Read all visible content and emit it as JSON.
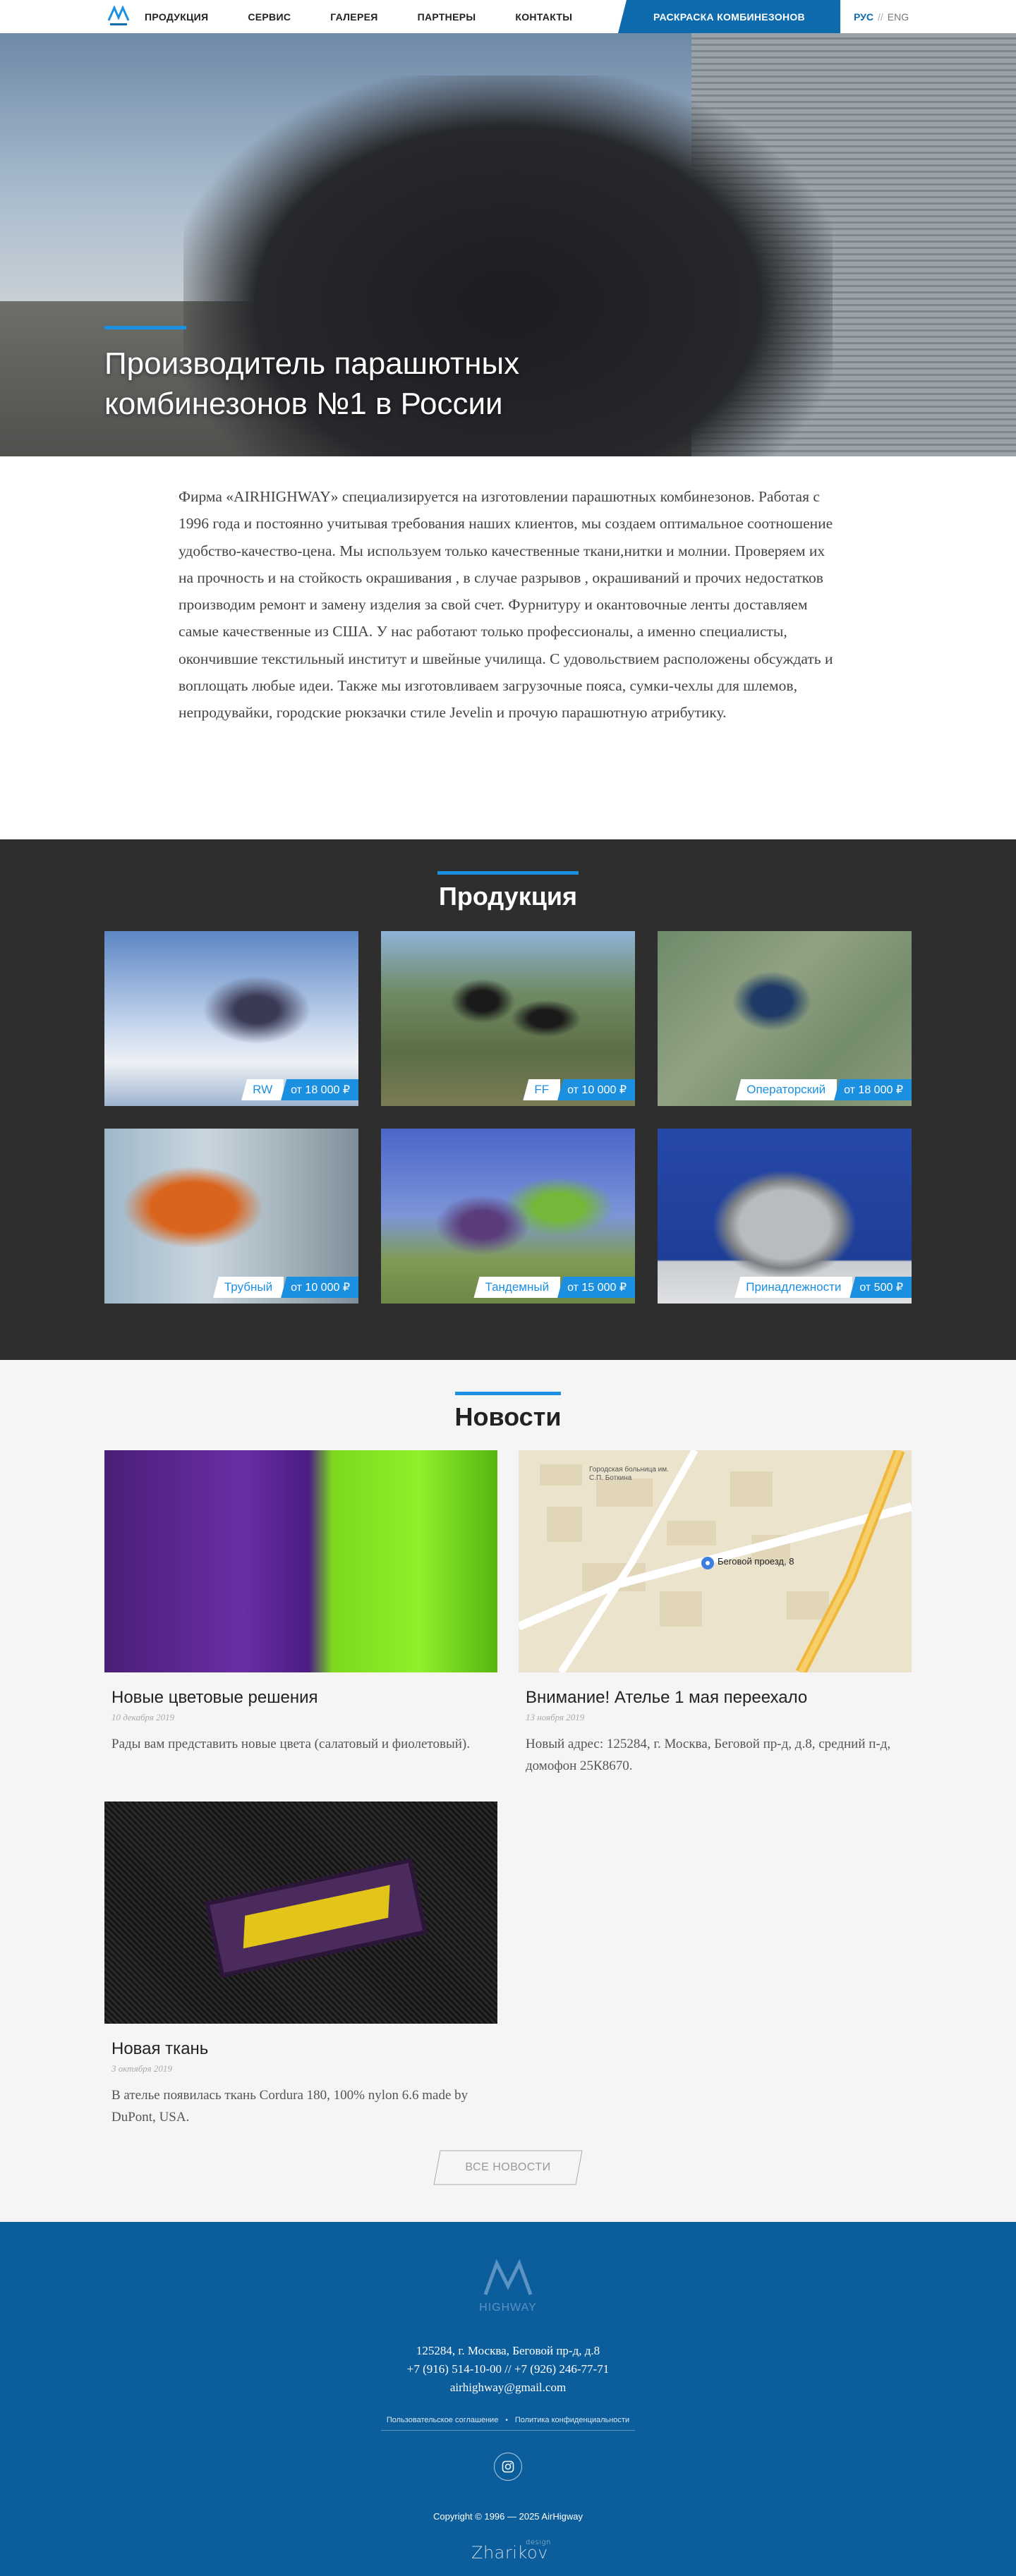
{
  "header": {
    "nav": [
      "ПРОДУКЦИЯ",
      "СЕРВИС",
      "ГАЛЕРЕЯ",
      "ПАРТНЕРЫ",
      "КОНТАКТЫ"
    ],
    "cta": "РАСКРАСКА КОМБИНЕЗОНОВ",
    "lang_active": "РУС",
    "lang_sep": "//",
    "lang_other": "ENG"
  },
  "hero": {
    "title_line1": "Производитель парашютных",
    "title_line2": "комбинезонов №1 в России"
  },
  "intro": {
    "text": "Фирма «AIRHIGHWAY» специализируется на изготовлении парашютных комбинезонов. Работая с 1996 года и постоянно учитывая требования наших клиентов, мы создаем оптимальное соотношение удобство-качество-цена. Мы используем только качественные ткани,нитки и молнии. Проверяем их на прочность  и  на стойкость окрашивания , в случае разрывов , окрашиваний и прочих недостатков производим ремонт и замену изделия за свой счет. Фурнитуру  и окантовочные  ленты доставляем самые качественные из США. У нас работают только профессионалы, а именно специалисты, окончившие текстильный институт и швейные училища. С удовольствием расположены обсуждать и воплощать любые идеи. Также мы изготовливаем загрузочные пояса, сумки-чехлы для шлемов, непродувайки, городские рюкзачки стиле Jevelin и прочую парашютную атрибутику."
  },
  "products": {
    "title": "Продукция",
    "items": [
      {
        "name": "RW",
        "price": "от 18 000 ₽"
      },
      {
        "name": "FF",
        "price": "от 10 000 ₽"
      },
      {
        "name": "Операторский",
        "price": "от 18 000 ₽"
      },
      {
        "name": "Трубный",
        "price": "от 10 000 ₽"
      },
      {
        "name": "Тандемный",
        "price": "от 15 000 ₽"
      },
      {
        "name": "Принадлежности",
        "price": "от 500 ₽"
      }
    ]
  },
  "news": {
    "title": "Новости",
    "items": [
      {
        "title": "Новые цветовые решения",
        "date": "10 декабря 2019",
        "text": "Рады вам представить новые цвета (салатовый и фиолетовый)."
      },
      {
        "title": "Внимание! Ателье 1 мая переехало",
        "date": "13 ноября 2019",
        "text": "Новый адрес: 125284, г. Москва, Беговой пр-д, д.8, средний п-д, домофон 25К8670."
      },
      {
        "title": "Новая ткань",
        "date": "3 октября 2019",
        "text": "В ателье появилась ткань Cordura 180, 100% nylon 6.6 made by DuPont, USA."
      }
    ],
    "map_label": "Беговой проезд, 8",
    "map_hospital": "Городская больница им. С.П. Боткина",
    "all_button": "ВСЕ НОВОСТИ"
  },
  "footer": {
    "logo_top": "AIR",
    "logo_bottom": "HIGHWAY",
    "address": "125284, г. Москва, Беговой пр-д, д.8",
    "phones": "+7 (916) 514-10-00 // +7 (926) 246-77-71",
    "email": "airhighway@gmail.com",
    "link_terms": "Пользовательское соглашение",
    "link_privacy": "Политика конфиденциальности",
    "copyright": "Copyright © 1996 — 2025 AirHigway",
    "designer": "Zharikov",
    "designer_small": "design"
  },
  "colors": {
    "accent": "#1b8fe0",
    "nav_cta": "#0d6aad",
    "footer": "#0b5d9b",
    "dark": "#2e2e2e"
  }
}
